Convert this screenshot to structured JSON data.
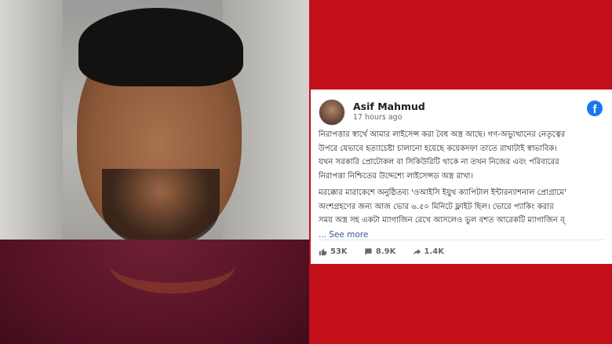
{
  "post": {
    "author": "Asif Mahmud",
    "time": "17 hours ago",
    "lines": [
      "নিরাপত্তার স্বার্থে আমার লাইসেন্স করা বৈধ অস্ত্র আছে। গণ-অভ্যুত্থানের নেতৃত্বের",
      "উপরে যেভাবে হত্যাচেষ্টা চালানো হয়েছে কয়েকদফা তাতে রাখাটাই স্বাভাবিক।",
      "যখন সরকারি প্রোটোকল বা সিকিউরিটি থাকে না তখন নিজের এবং পরিবারের",
      "নিরাপত্তা নিশ্চিতের উদ্দেশ্যে লাইসেন্সড অস্ত্র রাখা।",
      "মরক্কোর মারাকেশে অনুষ্ঠিতব্য 'ওআইসি ইয়ুথ ক্যাপিটাল ইন্টারন্যাশনাল প্রোগ্রামে'",
      "অংশগ্রহণের জন্য আজ ভোর ৬.৫০ মিনিটে ফ্লাইট ছিল। ভোরে প্যাকিং করার",
      "সময় অস্ত্র সহ একটা ম্যাগাজিন রেখে আসলেও ভুল বশত আরেকটি ম্যাগাজিন ব্"
    ],
    "see_more_dots": "...",
    "see_more": "See more",
    "likes": "53K",
    "comments": "8.9K",
    "shares": "1.4K"
  },
  "icons": {
    "platform": "facebook-icon",
    "like": "thumbs-up-icon",
    "comment": "comment-icon",
    "share": "share-icon"
  },
  "colors": {
    "background": "#c3101a",
    "facebook_blue": "#1877f2",
    "link": "#385898"
  }
}
